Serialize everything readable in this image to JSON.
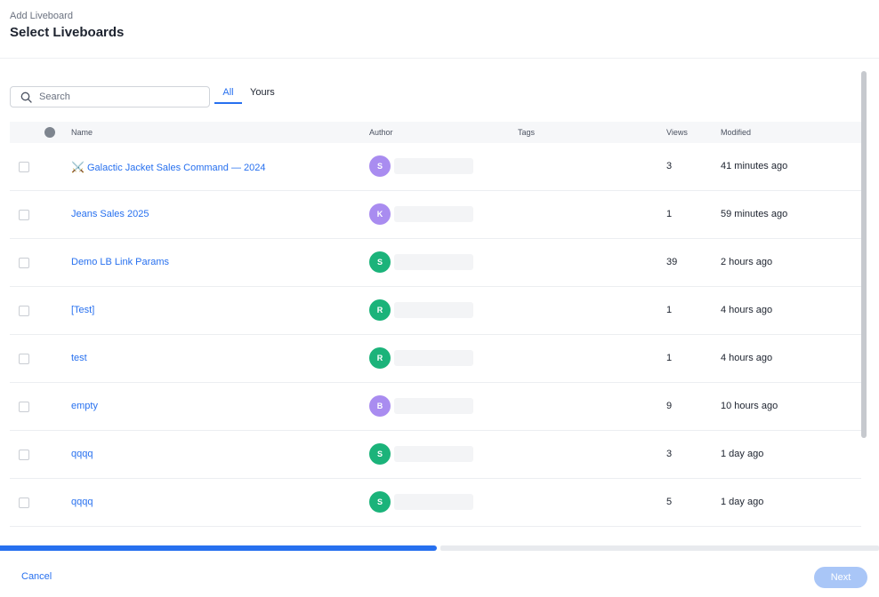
{
  "header": {
    "subtitle": "Add Liveboard",
    "title": "Select Liveboards"
  },
  "search": {
    "placeholder": "Search",
    "value": ""
  },
  "tabs": [
    {
      "label": "All",
      "active": true
    },
    {
      "label": "Yours",
      "active": false
    }
  ],
  "table": {
    "columns": {
      "name": "Name",
      "author": "Author",
      "tags": "Tags",
      "views": "Views",
      "modified": "Modified"
    },
    "rows": [
      {
        "emoji": "⚔️",
        "name": "Galactic Jacket Sales Command — 2024",
        "author_initial": "S",
        "author_color": "#a98cf0",
        "views": "3",
        "modified": "41 minutes ago"
      },
      {
        "emoji": "",
        "name": "Jeans Sales 2025",
        "author_initial": "K",
        "author_color": "#a98cf0",
        "views": "1",
        "modified": "59 minutes ago"
      },
      {
        "emoji": "",
        "name": "Demo LB Link Params",
        "author_initial": "S",
        "author_color": "#1bb37a",
        "views": "39",
        "modified": "2 hours ago"
      },
      {
        "emoji": "",
        "name": "[Test]",
        "author_initial": "R",
        "author_color": "#1bb37a",
        "views": "1",
        "modified": "4 hours ago"
      },
      {
        "emoji": "",
        "name": "test",
        "author_initial": "R",
        "author_color": "#1bb37a",
        "views": "1",
        "modified": "4 hours ago"
      },
      {
        "emoji": "",
        "name": "empty",
        "author_initial": "B",
        "author_color": "#a98cf0",
        "views": "9",
        "modified": "10 hours ago"
      },
      {
        "emoji": "",
        "name": "qqqq",
        "author_initial": "S",
        "author_color": "#1bb37a",
        "views": "3",
        "modified": "1 day ago"
      },
      {
        "emoji": "",
        "name": "qqqq",
        "author_initial": "S",
        "author_color": "#1bb37a",
        "views": "5",
        "modified": "1 day ago"
      }
    ]
  },
  "progress": {
    "percent": 50
  },
  "footer": {
    "cancel_label": "Cancel",
    "next_label": "Next"
  },
  "colors": {
    "accent": "#2770ef",
    "disabled_button": "#a9c6f7"
  }
}
